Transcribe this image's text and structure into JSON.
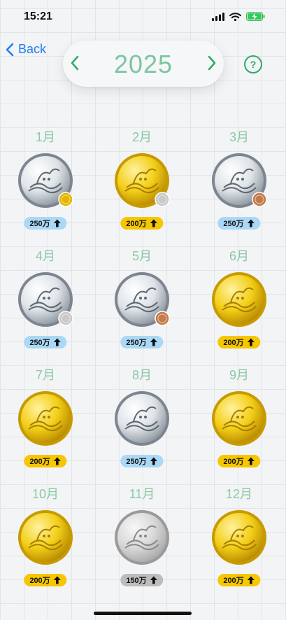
{
  "status_bar": {
    "time": "15:21"
  },
  "nav": {
    "back_label": "Back",
    "year": "2025"
  },
  "colors": {
    "gold": "#f6c600",
    "blue": "#aad8f6",
    "gray": "#bdbdbd",
    "accent_green": "#2fa86a",
    "link_blue": "#1e7ef0"
  },
  "months": [
    {
      "month": "1月",
      "coin": "platinum",
      "mini": "gold",
      "badge": "250万",
      "badge_color": "blue"
    },
    {
      "month": "2月",
      "coin": "gold",
      "mini": "silver",
      "badge": "200万",
      "badge_color": "gold"
    },
    {
      "month": "3月",
      "coin": "platinum",
      "mini": "bronze",
      "badge": "250万",
      "badge_color": "blue"
    },
    {
      "month": "4月",
      "coin": "platinum",
      "mini": "silver",
      "badge": "250万",
      "badge_color": "blue"
    },
    {
      "month": "5月",
      "coin": "platinum",
      "mini": "bronze",
      "badge": "250万",
      "badge_color": "blue"
    },
    {
      "month": "6月",
      "coin": "gold",
      "mini": "",
      "badge": "200万",
      "badge_color": "gold"
    },
    {
      "month": "7月",
      "coin": "gold",
      "mini": "",
      "badge": "200万",
      "badge_color": "gold"
    },
    {
      "month": "8月",
      "coin": "platinum",
      "mini": "",
      "badge": "250万",
      "badge_color": "blue"
    },
    {
      "month": "9月",
      "coin": "gold",
      "mini": "",
      "badge": "200万",
      "badge_color": "gold"
    },
    {
      "month": "10月",
      "coin": "gold",
      "mini": "",
      "badge": "200万",
      "badge_color": "gold"
    },
    {
      "month": "11月",
      "coin": "silver",
      "mini": "",
      "badge": "150万",
      "badge_color": "gray"
    },
    {
      "month": "12月",
      "coin": "gold",
      "mini": "",
      "badge": "200万",
      "badge_color": "gold"
    }
  ]
}
